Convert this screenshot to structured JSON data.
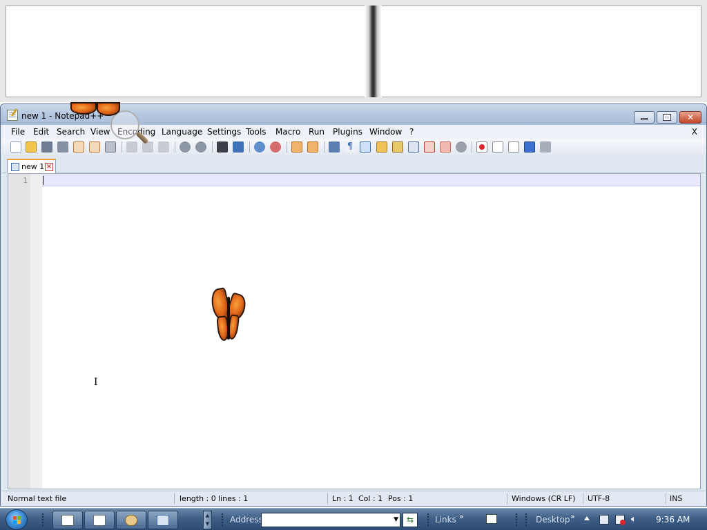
{
  "window": {
    "title": "new 1 - Notepad++",
    "controls": {
      "minimize": "minimize",
      "maximize": "maximize",
      "close": "✕"
    }
  },
  "menu": {
    "items": [
      "File",
      "Edit",
      "Search",
      "View",
      "Encoding",
      "Language",
      "Settings",
      "Tools",
      "Macro",
      "Run",
      "Plugins",
      "Window",
      "?"
    ],
    "close_label": "X"
  },
  "toolbar": {
    "icons": [
      "new-file-icon",
      "open-file-icon",
      "save-icon",
      "save-all-icon",
      "close-icon",
      "close-all-icon",
      "print-icon",
      "cut-icon",
      "copy-icon",
      "paste-icon",
      "undo-icon",
      "redo-icon",
      "find-icon",
      "replace-icon",
      "zoom-in-icon",
      "zoom-out-icon",
      "sync-vertical-icon",
      "sync-horizontal-icon",
      "word-wrap-icon",
      "show-all-chars-icon",
      "indent-guide-icon",
      "user-language-icon",
      "document-map-icon",
      "function-list-icon",
      "folder-as-workspace-icon",
      "monitoring-icon",
      "record-macro-icon",
      "stop-macro-icon",
      "playback-macro-icon",
      "run-macro-multiple-icon",
      "save-macro-icon"
    ]
  },
  "tabs": [
    {
      "label": "new 1",
      "active": true
    }
  ],
  "editor": {
    "line_numbers": [
      "1"
    ],
    "content": ""
  },
  "statusbar": {
    "file_type": "Normal text file",
    "length": "length : 0",
    "lines": "lines : 1",
    "ln": "Ln : 1",
    "col": "Col : 1",
    "pos": "Pos : 1",
    "eol": "Windows (CR LF)",
    "encoding": "UTF-8",
    "mode": "INS"
  },
  "taskbar": {
    "address_label": "Address",
    "address_value": "",
    "links_label": "Links",
    "desktop_label": "Desktop",
    "clock": "9:36 AM",
    "chevron": "»"
  },
  "colors": {
    "title_gradient_top": "#ccd9ea",
    "current_line": "#e8e8ff",
    "taskbar": "#3f5f86",
    "butterfly_orange": "#e2661a"
  }
}
